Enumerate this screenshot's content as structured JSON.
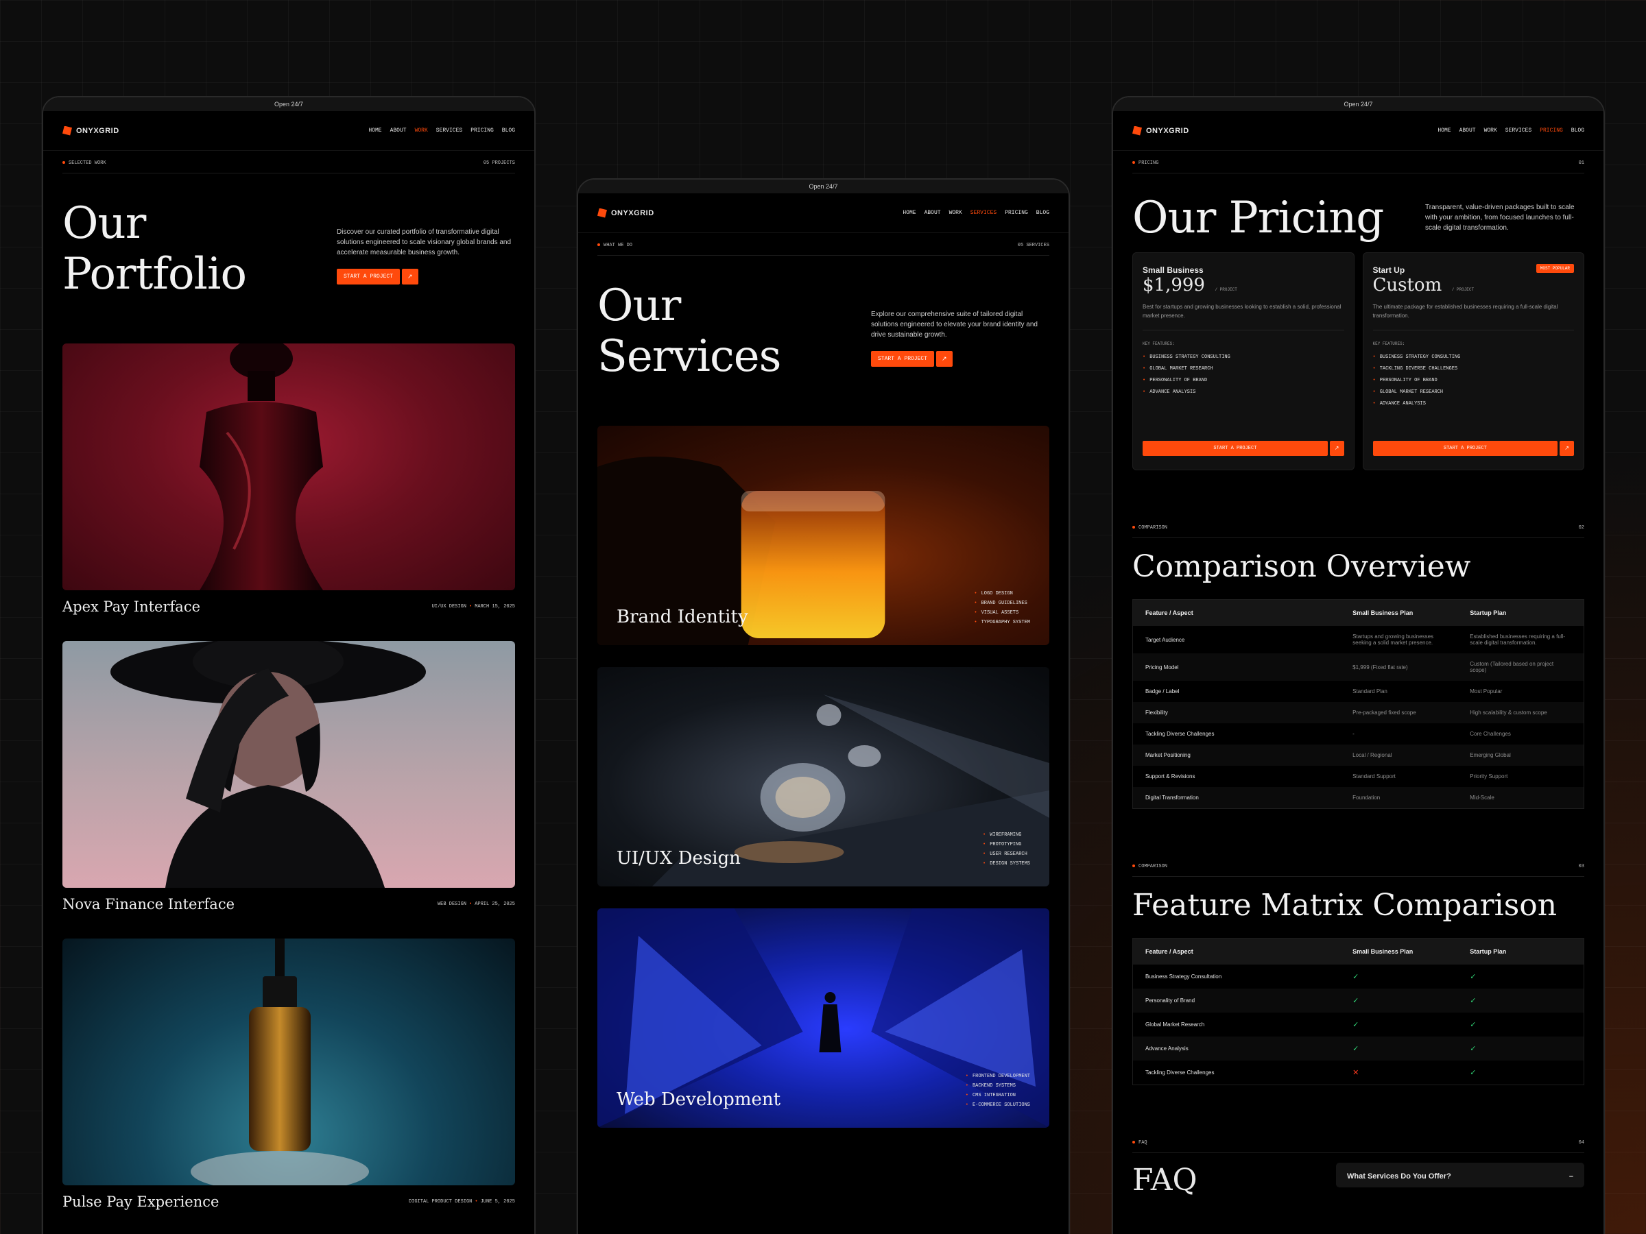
{
  "topbar": "Open 24/7",
  "brand": "ONYXGRID",
  "nav": [
    "HOME",
    "ABOUT",
    "WORK",
    "SERVICES",
    "PRICING",
    "BLOG"
  ],
  "portfolio": {
    "eyebrow_label": "SELECTED WORK",
    "eyebrow_count": "05 PROJECTS",
    "title_line1": "Our",
    "title_line2": "Portfolio",
    "intro": "Discover our curated portfolio of transformative digital solutions engineered to scale visionary global brands and accelerate measurable business growth.",
    "cta": "START A PROJECT",
    "cta_arrow": "↗",
    "projects": [
      {
        "title": "Apex Pay Interface",
        "category": "UI/UX DESIGN",
        "date": "MARCH 15, 2025"
      },
      {
        "title": "Nova Finance Interface",
        "category": "WEB DESIGN",
        "date": "APRIL 25, 2025"
      },
      {
        "title": "Pulse Pay Experience",
        "category": "DIGITAL PRODUCT DESIGN",
        "date": "JUNE 5, 2025"
      }
    ]
  },
  "services": {
    "eyebrow_label": "WHAT WE DO",
    "eyebrow_count": "05 SERVICES",
    "title_line1": "Our",
    "title_line2": "Services",
    "intro": "Explore our comprehensive suite of tailored digital solutions engineered to elevate your brand identity and drive sustainable growth.",
    "cta": "START A PROJECT",
    "cta_arrow": "↗",
    "items": [
      {
        "title": "Brand Identity",
        "features": [
          "LOGO DESIGN",
          "BRAND GUIDELINES",
          "VISUAL ASSETS",
          "TYPOGRAPHY SYSTEM"
        ]
      },
      {
        "title": "UI/UX Design",
        "features": [
          "WIREFRAMING",
          "PROTOTYPING",
          "USER RESEARCH",
          "DESIGN SYSTEMS"
        ]
      },
      {
        "title": "Web Development",
        "features": [
          "FRONTEND DEVELOPMENT",
          "BACKEND SYSTEMS",
          "CMS INTEGRATION",
          "E-COMMERCE SOLUTIONS"
        ]
      }
    ]
  },
  "pricing": {
    "eyebrow_label": "PRICING",
    "eyebrow_count": "01",
    "title": "Our Pricing",
    "intro": "Transparent, value-driven packages built to scale with your ambition, from focused launches to full-scale digital transformation.",
    "plans": [
      {
        "name": "Small Business",
        "price": "$1,999",
        "per": "/ PROJECT",
        "badge": "",
        "desc": "Best for startups and growing businesses looking to establish a solid, professional market presence.",
        "features_label": "KEY FEATURES:",
        "features": [
          "BUSINESS STRATEGY CONSULTING",
          "GLOBAL MARKET RESEARCH",
          "PERSONALITY OF BRAND",
          "ADVANCE ANALYSIS"
        ],
        "cta": "START A PROJECT",
        "cta_arrow": "↗"
      },
      {
        "name": "Start Up",
        "price": "Custom",
        "per": "/ PROJECT",
        "badge": "MOST POPULAR",
        "desc": "The ultimate package for established businesses requiring a full-scale digital transformation.",
        "features_label": "KEY FEATURES:",
        "features": [
          "BUSINESS STRATEGY CONSULTING",
          "TACKLING DIVERSE CHALLENGES",
          "PERSONALITY OF BRAND",
          "GLOBAL MARKET RESEARCH",
          "ADVANCE ANALYSIS"
        ],
        "cta": "START A PROJECT",
        "cta_arrow": "↗"
      }
    ],
    "comparison": {
      "eyebrow_label": "COMPARISON",
      "eyebrow_count": "02",
      "title": "Comparison Overview",
      "headers": [
        "Feature / Aspect",
        "Small Business Plan",
        "Startup Plan"
      ],
      "rows": [
        [
          "Target Audience",
          "Startups and growing businesses seeking a solid market presence.",
          "Established businesses requiring a full-scale digital transformation."
        ],
        [
          "Pricing Model",
          "$1,999 (Fixed flat rate)",
          "Custom (Tailored based on project scope)"
        ],
        [
          "Badge / Label",
          "Standard Plan",
          "Most Popular"
        ],
        [
          "Flexibility",
          "Pre-packaged fixed scope",
          "High scalability & custom scope"
        ],
        [
          "Tackling Diverse Challenges",
          "-",
          "Core Challenges"
        ],
        [
          "Market Positioning",
          "Local / Regional",
          "Emerging Global"
        ],
        [
          "Support & Revisions",
          "Standard Support",
          "Priority Support"
        ],
        [
          "Digital Transformation",
          "Foundation",
          "Mid-Scale"
        ]
      ]
    },
    "matrix": {
      "eyebrow_label": "COMPARISON",
      "eyebrow_count": "03",
      "title": "Feature Matrix Comparison",
      "headers": [
        "Feature / Aspect",
        "Small Business Plan",
        "Startup Plan"
      ],
      "rows": [
        [
          "Business Strategy Consultation",
          "✓",
          "✓"
        ],
        [
          "Personality of Brand",
          "✓",
          "✓"
        ],
        [
          "Global Market Research",
          "✓",
          "✓"
        ],
        [
          "Advance Analysis",
          "✓",
          "✓"
        ],
        [
          "Tackling Diverse Challenges",
          "✕",
          "✓"
        ]
      ]
    },
    "faq": {
      "eyebrow_label": "FAQ",
      "eyebrow_count": "04",
      "title": "FAQ",
      "question": "What Services Do You Offer?",
      "toggle": "–"
    }
  }
}
